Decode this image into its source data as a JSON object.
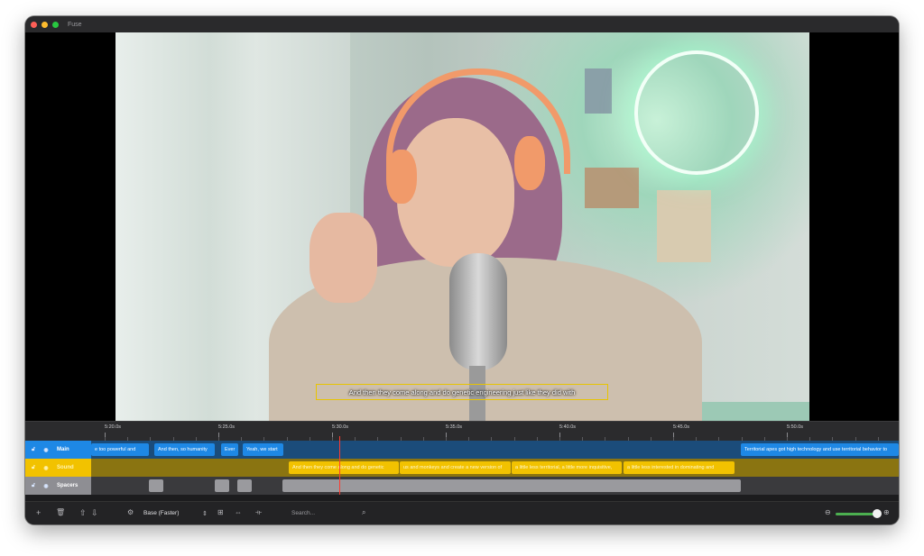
{
  "app": {
    "title": "Fuse"
  },
  "subtitle_overlay": "And then they come along and do genetic engineering just like they did with",
  "ruler": {
    "labels": [
      "5:20.0s",
      "5:25.0s",
      "5:30.0s",
      "5:35.0s",
      "5:40.0s",
      "5:45.0s",
      "5:50.0s"
    ]
  },
  "tracks": [
    {
      "name": "Main",
      "color": "#1e88e5",
      "clips": [
        {
          "text": "e too powerful and"
        },
        {
          "text": "And then, so humanity"
        },
        {
          "text": "Ever"
        },
        {
          "text": "Yeah, we start"
        },
        {
          "text": "Territorial apes got high technology and use territorial behavior to"
        }
      ]
    },
    {
      "name": "Sound",
      "color": "#f2c200",
      "clips": [
        {
          "text": "And then they come along and do genetic"
        },
        {
          "text": "us and monkeys and create a new version of"
        },
        {
          "text": "a little less territorial, a little more inquisitive,"
        },
        {
          "text": "a little less interested in dominating and"
        }
      ]
    },
    {
      "name": "Spacers",
      "color": "#8e8e93",
      "clips": [
        {
          "text": ""
        },
        {
          "text": ""
        },
        {
          "text": ""
        },
        {
          "text": ""
        }
      ]
    }
  ],
  "toolbar": {
    "model_select": "Base (Faster)",
    "search_placeholder": "Search...",
    "icons": [
      "plus-icon",
      "trash-icon",
      "arrow-up-icon",
      "arrow-down-icon",
      "settings-icon",
      "add-box-icon",
      "fit-width-icon",
      "split-icon",
      "search-icon",
      "zoom-out-icon",
      "zoom-in-icon"
    ],
    "zoom_level": 0.9
  }
}
